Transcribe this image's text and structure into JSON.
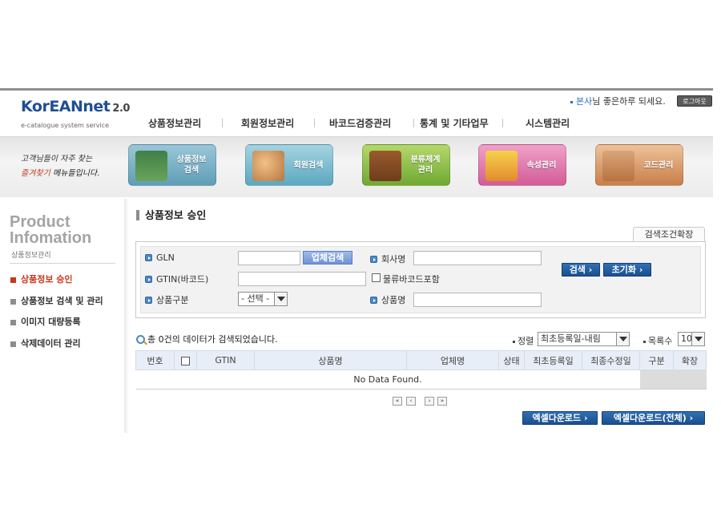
{
  "header": {
    "logo_main": "KorEANnet",
    "logo_version": "2.0",
    "logo_sub": "e-catalogue system service",
    "greeting_name": "본사",
    "greeting_text": "님 좋은하루 되세요.",
    "logout_label": "로그아웃"
  },
  "gnb": [
    "상품정보관리",
    "회원정보관리",
    "바코드검증관리",
    "통계 및 기타업무",
    "시스템관리"
  ],
  "banner": {
    "slogan_line1": "고객님들이 자주 찾는",
    "slogan_line2_red": "즐겨찾기",
    "slogan_line2_rest": " 메뉴들입니다.",
    "quick_links": [
      {
        "label": "상품정보\n검색",
        "icon": "product-binder-icon"
      },
      {
        "label": "회원검색",
        "icon": "members-icon"
      },
      {
        "label": "분류체계\n관리",
        "icon": "cabinet-icon"
      },
      {
        "label": "속성관리",
        "icon": "attribute-folders-icon"
      },
      {
        "label": "코드관리",
        "icon": "code-folder-icon"
      }
    ]
  },
  "sidebar": {
    "title_line1": "Product",
    "title_line2": "Infomation",
    "subtitle": "상품정보관리",
    "items": [
      {
        "label": "상품정보 승인",
        "active": true
      },
      {
        "label": "상품정보 검색 및 관리",
        "active": false
      },
      {
        "label": "이미지 대량등록",
        "active": false
      },
      {
        "label": "삭제데이터 관리",
        "active": false
      }
    ]
  },
  "main": {
    "page_title": "상품정보 승인",
    "expand_label": "검색조건확장",
    "search": {
      "gln_label": "GLN",
      "gln_value": "",
      "company_search_button": "업체검색",
      "company_name_label": "회사명",
      "company_name_value": "",
      "gtin_label": "GTIN(바코드)",
      "gtin_value": "",
      "logistics_checkbox_label": "물류바코드포함",
      "category_label": "상품구분",
      "category_value": "- 선택 -",
      "product_name_label": "상품명",
      "product_name_value": "",
      "search_button": "검색 ›",
      "reset_button": "초기화 ›"
    },
    "result_message": "총 0건의 데이터가 검색되었습니다.",
    "sort_label": "정렬",
    "sort_value": "최초등록일-내림",
    "page_size_label": "목록수",
    "page_size_value": "10",
    "table": {
      "columns": [
        "번호",
        "",
        "GTIN",
        "상품명",
        "업체명",
        "상태",
        "최초등록일",
        "최종수정일",
        "구분",
        "확장"
      ],
      "empty_message": "No Data Found."
    },
    "pager": {
      "first": "«",
      "prev": "‹",
      "next": "›",
      "last": "»"
    },
    "excel_download": "엑셀다운로드 ›",
    "excel_download_all": "엑셀다운로드(전체) ›"
  },
  "colors": {
    "brand_blue": "#1f4e94",
    "active_red": "#c8371a",
    "button_blue": "#1b4f8e"
  }
}
